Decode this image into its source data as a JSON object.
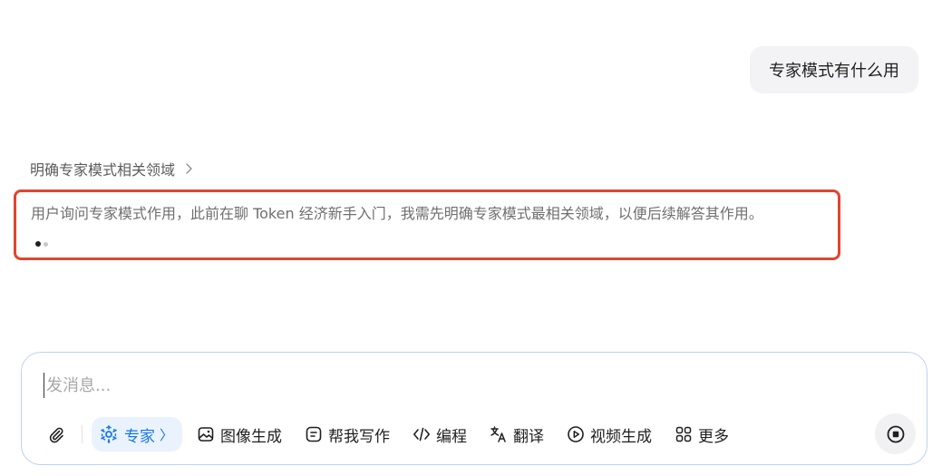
{
  "user_message": "专家模式有什么用",
  "thinking": {
    "title": "明确专家模式相关领域",
    "text": "用户询问专家模式作用，此前在聊 Token 经济新手入门，我需先明确专家模式最相关领域，以便后续解答其作用。"
  },
  "composer": {
    "placeholder": "发消息...",
    "expert_label": "专家",
    "expert_caret": "〉",
    "tools": [
      {
        "label": "图像生成",
        "icon": "image-icon"
      },
      {
        "label": "帮我写作",
        "icon": "writing-icon"
      },
      {
        "label": "编程",
        "icon": "code-icon"
      },
      {
        "label": "翻译",
        "icon": "translate-icon"
      },
      {
        "label": "视频生成",
        "icon": "video-icon"
      },
      {
        "label": "更多",
        "icon": "grid-icon"
      }
    ]
  },
  "colors": {
    "accent": "#1677e5",
    "highlight_border": "#e2452f",
    "bubble_bg": "#f3f3f5"
  }
}
